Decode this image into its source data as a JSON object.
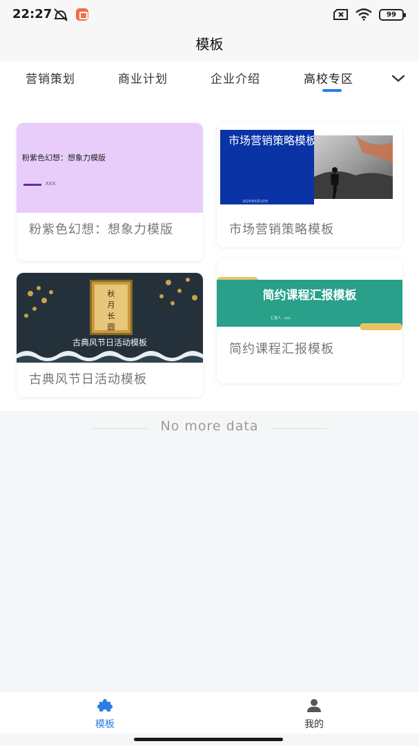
{
  "status_bar": {
    "time": "22:27",
    "battery": "99",
    "icons": [
      "mute-icon",
      "app-notification-icon",
      "sim-off-icon",
      "wifi-icon",
      "battery-icon"
    ]
  },
  "nav": {
    "title": "模板"
  },
  "tabs": {
    "items": [
      {
        "label": "营销策划"
      },
      {
        "label": "商业计划"
      },
      {
        "label": "企业介绍"
      },
      {
        "label": "高校专区"
      }
    ],
    "active_index": 3,
    "more_icon": "chevron-down-icon",
    "accent": "#2a7de1"
  },
  "templates": [
    {
      "title": "粉紫色幻想：想象力模版",
      "thumb_text": "粉紫色幻想：想象力模版",
      "thumb_sub": "XXX"
    },
    {
      "title": "市场营销策略模板",
      "thumb_text": "市场营销策略模板",
      "thumb_date": "2024年6月10日"
    },
    {
      "title": "古典风节日活动模板",
      "thumb_text": "古典风节日活动模板",
      "thumb_scroll": "秋月长圆"
    },
    {
      "title": "简约课程汇报模板",
      "thumb_text": "简约课程汇报模板",
      "thumb_sub": "汇报人：xxx"
    }
  ],
  "footer": {
    "no_more": "No more data"
  },
  "bottom_nav": {
    "items": [
      {
        "label": "模板",
        "icon": "puzzle-icon",
        "active": true
      },
      {
        "label": "我的",
        "icon": "user-icon",
        "active": false
      }
    ],
    "active_color": "#2a7de1",
    "inactive_color": "#333333"
  }
}
